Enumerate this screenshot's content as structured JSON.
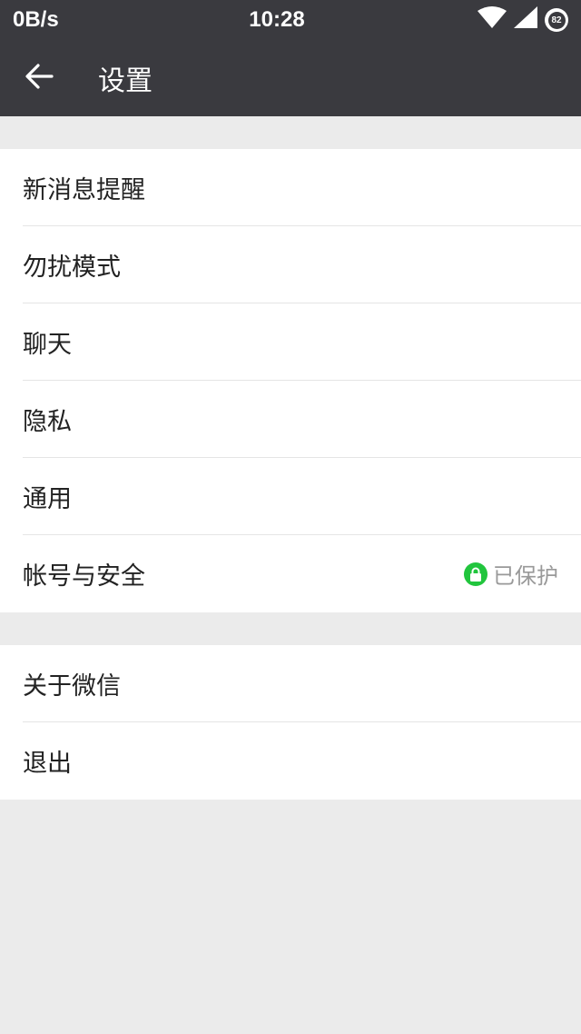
{
  "status_bar": {
    "net_speed": "0B/s",
    "time": "10:28",
    "battery": "82"
  },
  "header": {
    "title": "设置"
  },
  "groups": [
    {
      "items": [
        {
          "label": "新消息提醒"
        },
        {
          "label": "勿扰模式"
        },
        {
          "label": "聊天"
        },
        {
          "label": "隐私"
        },
        {
          "label": "通用"
        },
        {
          "label": "帐号与安全",
          "status": "已保护",
          "status_color": "#21c53d"
        }
      ]
    },
    {
      "items": [
        {
          "label": "关于微信"
        },
        {
          "label": "退出"
        }
      ]
    }
  ],
  "colors": {
    "header_bg": "#3a3a3f",
    "page_bg": "#ebebeb",
    "accent_green": "#21c53d"
  },
  "icons": {
    "back": "arrow-left-icon",
    "wifi": "wifi-icon",
    "signal": "cell-signal-icon",
    "battery": "battery-ring-icon",
    "lock": "lock-icon"
  }
}
